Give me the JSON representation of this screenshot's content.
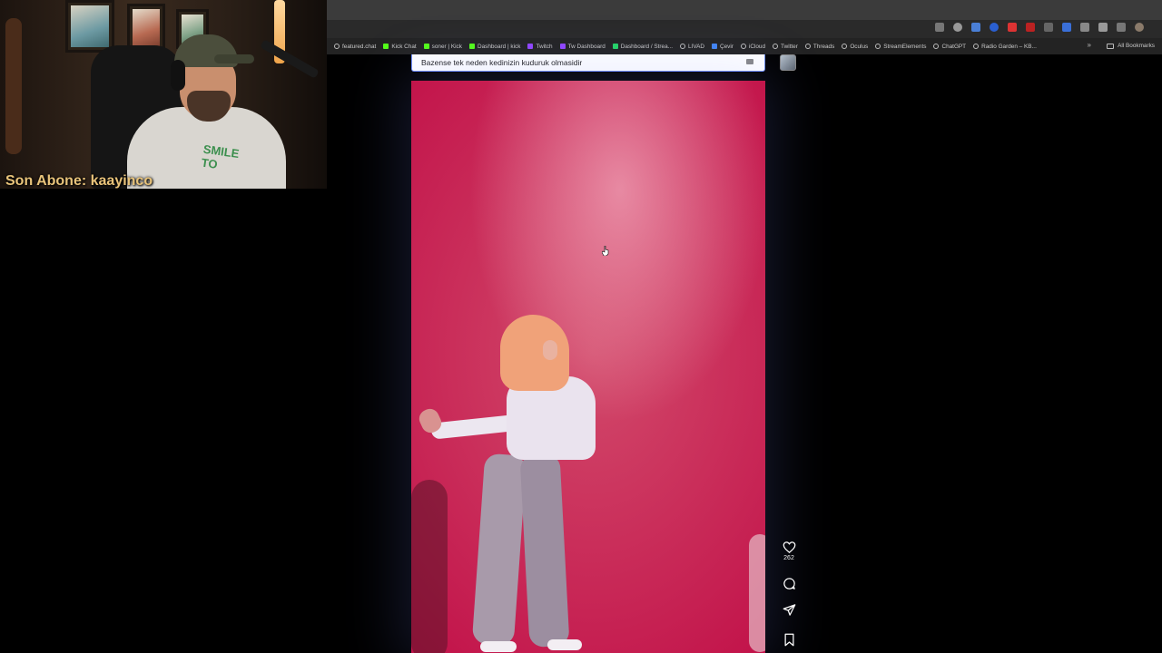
{
  "bookmarks": [
    {
      "label": "featured.chat",
      "icon": "globe-icon"
    },
    {
      "label": "Kick Chat",
      "icon": "kick-icon"
    },
    {
      "label": "soner | Kick",
      "icon": "kick-icon"
    },
    {
      "label": "Dashboard | kick",
      "icon": "kick-icon"
    },
    {
      "label": "Twitch",
      "icon": "twitch-icon"
    },
    {
      "label": "Tw Dashboard",
      "icon": "twitch-icon"
    },
    {
      "label": "Dashboard / Strea...",
      "icon": "streamelements-icon"
    },
    {
      "label": "LIVAD",
      "icon": "globe-icon"
    },
    {
      "label": "Çevir",
      "icon": "translate-icon"
    },
    {
      "label": "iCloud",
      "icon": "globe-icon"
    },
    {
      "label": "Twitter",
      "icon": "globe-icon"
    },
    {
      "label": "Threads",
      "icon": "globe-icon"
    },
    {
      "label": "Oculus",
      "icon": "globe-icon"
    },
    {
      "label": "StreamElements",
      "icon": "globe-icon"
    },
    {
      "label": "ChatGPT",
      "icon": "globe-icon"
    },
    {
      "label": "Radio Garden – KB...",
      "icon": "globe-icon"
    }
  ],
  "all_bookmarks_label": "All Bookmarks",
  "bookmarks_more": "»",
  "post": {
    "caption": "Bazense tek neden kedinizin kuduruk olmasidir",
    "likes": "262"
  },
  "overlay": {
    "subscriber_label": "Son Abone: kaayinco",
    "shirt_text": "SMILE TO"
  },
  "colors": {
    "video_bg": "#c2134a",
    "subscriber_text": "#e8c37a"
  }
}
